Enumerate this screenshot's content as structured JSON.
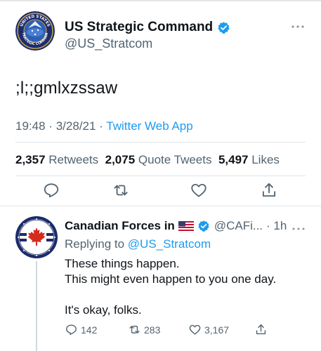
{
  "tweet": {
    "author_name": "US Strategic Command",
    "handle": "@US_Stratcom",
    "text": ";l;;gmlxzssaw",
    "time": "19:48",
    "date": "3/28/21",
    "separator": "·",
    "source": "Twitter Web App",
    "retweets_count": "2,357",
    "retweets_label": "Retweets",
    "quotes_count": "2,075",
    "quotes_label": "Quote Tweets",
    "likes_count": "5,497",
    "likes_label": "Likes",
    "icons": [
      "reply-icon",
      "retweet-icon",
      "like-icon",
      "share-icon",
      "verified-icon",
      "more-icon"
    ],
    "avatar_text_top": "UNITED STATES",
    "avatar_text_bottom": "STRATEGIC COMMAND"
  },
  "reply": {
    "author_name": "Canadian Forces in",
    "handle": "@CAFi...",
    "age": "· 1h",
    "replying_prefix": "Replying to",
    "replying_mention": "@US_Stratcom",
    "line1": "These things happen.",
    "line2": "This might even happen to you one day.",
    "line3": "It's okay, folks.",
    "reply_count": "142",
    "retweet_count": "283",
    "like_count": "3,167",
    "icons": [
      "flag-icon",
      "verified-icon",
      "more-icon",
      "reply-icon",
      "retweet-icon",
      "like-icon",
      "share-icon"
    ]
  },
  "colors": {
    "accent": "#1d9bf0",
    "secondary_text": "#536471",
    "primary_text": "#0f1419",
    "divider": "#dfe3e6"
  }
}
